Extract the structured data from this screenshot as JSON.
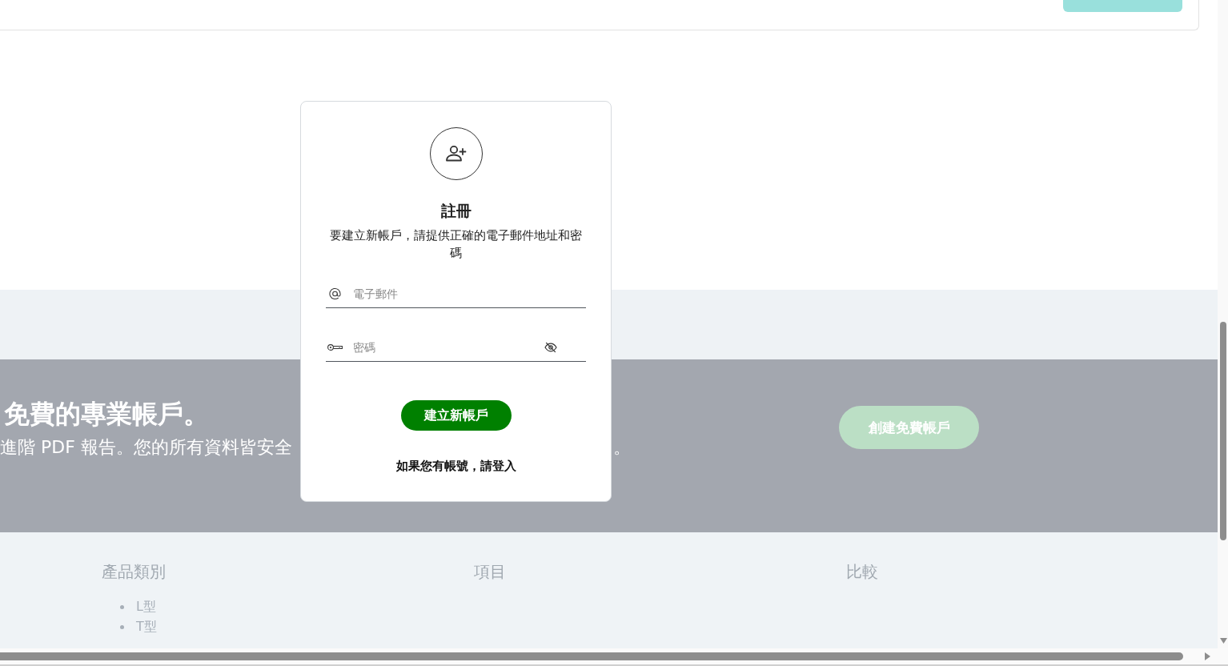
{
  "signup_card": {
    "title": "註冊",
    "description": "要建立新帳戶，請提供正確的電子郵件地址和密碼",
    "email_field": {
      "placeholder": "電子郵件"
    },
    "password_field": {
      "placeholder": "密碼"
    },
    "submit_button": "建立新帳戶",
    "login_prompt": "如果您有帳號，請登入"
  },
  "banner": {
    "heading": "免費的專業帳戶。",
    "subtitle": "進階 PDF 報告。您的所有資料皆安全",
    "subtitle_tail": "。",
    "button": "創建免費帳戶"
  },
  "footer": {
    "columns": [
      {
        "heading": "產品類別",
        "items": [
          "L型",
          "T型"
        ]
      },
      {
        "heading": "項目"
      },
      {
        "heading": "比較"
      }
    ]
  }
}
